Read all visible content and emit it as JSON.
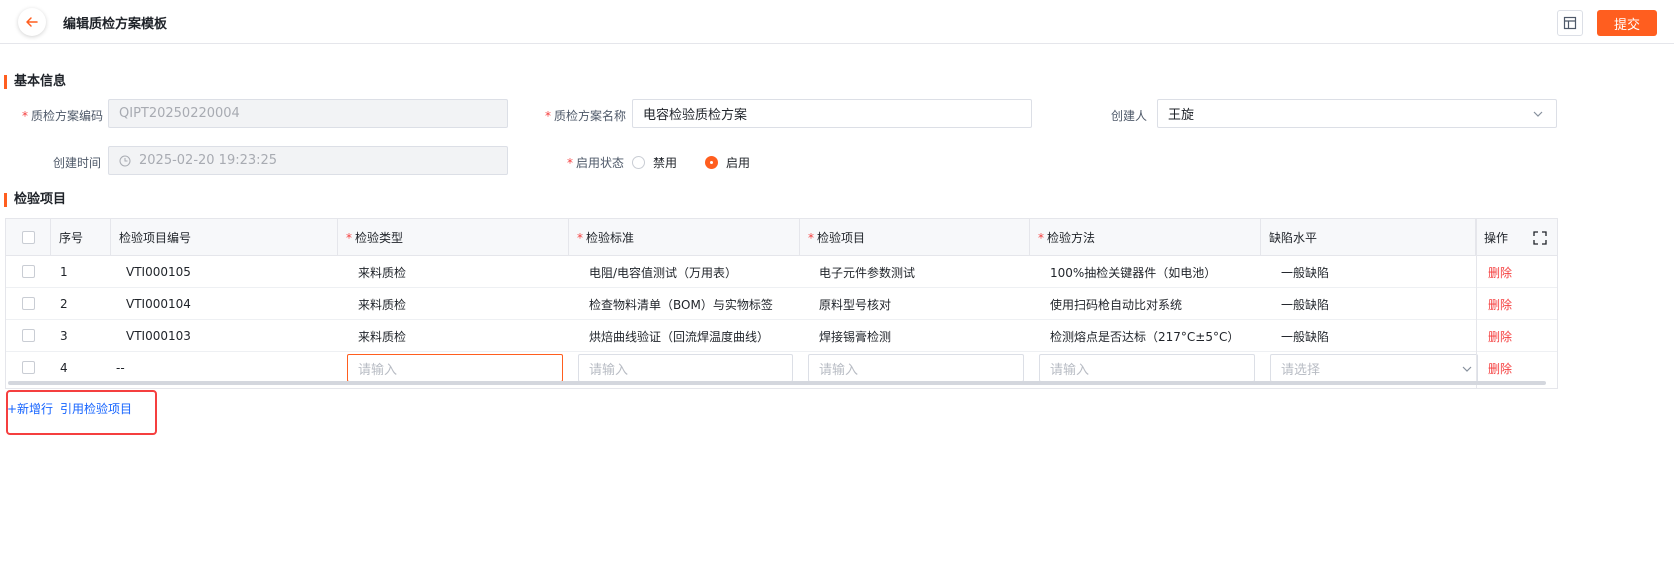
{
  "header": {
    "title": "编辑质检方案模板",
    "submit_label": "提交",
    "back_icon": "arrow-left-icon",
    "layout_icon": "layout-icon"
  },
  "basic": {
    "section_title": "基本信息",
    "code_label": "质检方案编码",
    "code_value": "QIPT20250220004",
    "name_label": "质检方案名称",
    "name_value": "电容检验质检方案",
    "creator_label": "创建人",
    "creator_value": "王旋",
    "created_time_label": "创建时间",
    "created_time_value": "2025-02-20 19:23:25",
    "status_label": "启用状态",
    "status_disabled": "禁用",
    "status_enabled": "启用",
    "status_selected": "启用"
  },
  "items": {
    "section_title": "检验项目",
    "columns": {
      "seq": "序号",
      "code": "检验项目编号",
      "type": "检验类型",
      "standard": "检验标准",
      "item": "检验项目",
      "method": "检验方法",
      "defect": "缺陷水平",
      "action": "操作"
    },
    "rows": [
      {
        "seq": "1",
        "code": "VTI000105",
        "type": "来料质检",
        "standard": "电阻/电容值测试（万用表）",
        "item": "电子元件参数测试",
        "method": "100%抽检关键器件（如电池）",
        "defect": "一般缺陷",
        "action": "删除"
      },
      {
        "seq": "2",
        "code": "VTI000104",
        "type": "来料质检",
        "standard": "检查物料清单（BOM）与实物标签",
        "item": "原料型号核对",
        "method": "使用扫码枪自动比对系统",
        "defect": "一般缺陷",
        "action": "删除"
      },
      {
        "seq": "3",
        "code": "VTI000103",
        "type": "来料质检",
        "standard": "烘焙曲线验证（回流焊温度曲线）",
        "item": "焊接锡膏检测",
        "method": "检测熔点是否达标（217°C±5°C）",
        "defect": "一般缺陷",
        "action": "删除"
      }
    ],
    "new_row": {
      "seq": "4",
      "code": "--",
      "input_placeholder": "请输入",
      "select_placeholder": "请选择",
      "action": "删除"
    },
    "add_row_label": "+新增行",
    "reference_label": "引用检验项目"
  },
  "colors": {
    "accent": "#ff5e1f",
    "danger": "#f53f3f",
    "link": "#1664ff"
  }
}
